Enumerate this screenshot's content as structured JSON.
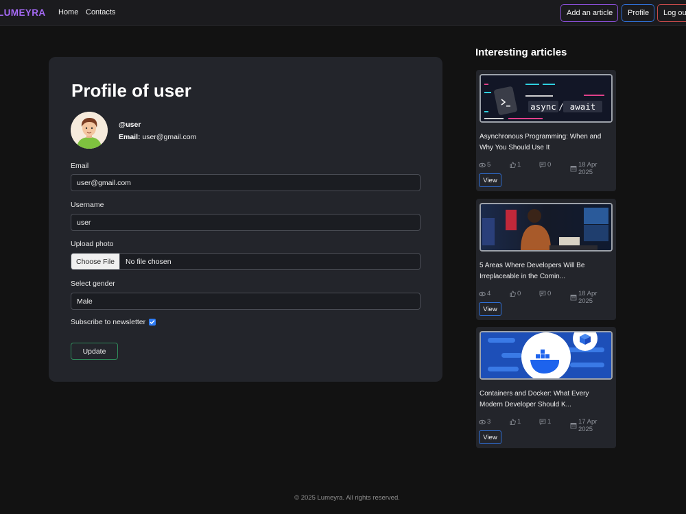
{
  "nav": {
    "brand": "LUMEYRA",
    "links": [
      "Home",
      "Contacts"
    ],
    "add_article": "Add an article",
    "profile": "Profile",
    "logout": "Log out"
  },
  "profile": {
    "title": "Profile of user",
    "handle": "@user",
    "email_label": "Email:",
    "email_value": "user@gmail.com"
  },
  "form": {
    "email_label": "Email",
    "email_value": "user@gmail.com",
    "username_label": "Username",
    "username_value": "user",
    "photo_label": "Upload photo",
    "file_button": "Choose File",
    "file_status": "No file chosen",
    "gender_label": "Select gender",
    "gender_value": "Male",
    "newsletter_label": "Subscribe to newsletter",
    "newsletter_checked": true,
    "update_button": "Update"
  },
  "sidebar": {
    "title": "Interesting articles",
    "articles": [
      {
        "title": "Asynchronous Programming: When and Why You Should Use It",
        "views": "5",
        "likes": "1",
        "comments": "0",
        "date": "18 Apr 2025",
        "view_label": "View",
        "thumb_words": [
          "async",
          "/",
          "await"
        ]
      },
      {
        "title": "5 Areas Where Developers Will Be Irreplaceable in the Comin...",
        "views": "4",
        "likes": "0",
        "comments": "0",
        "date": "18 Apr 2025",
        "view_label": "View"
      },
      {
        "title": "Containers and Docker: What Every Modern Developer Should K...",
        "views": "3",
        "likes": "1",
        "comments": "1",
        "date": "17 Apr 2025",
        "view_label": "View"
      }
    ]
  },
  "footer": "© 2025 Lumeyra. All rights reserved.",
  "colors": {
    "brand": "#a66af5",
    "background": "#121212",
    "card": "#23252b",
    "primary_outline": "#2f6fd6",
    "success_outline": "#2f8a5a",
    "danger_outline": "#c84a4a"
  },
  "icons": [
    "eye-icon",
    "thumbs-up-icon",
    "comment-icon",
    "calendar-icon",
    "check-icon"
  ]
}
